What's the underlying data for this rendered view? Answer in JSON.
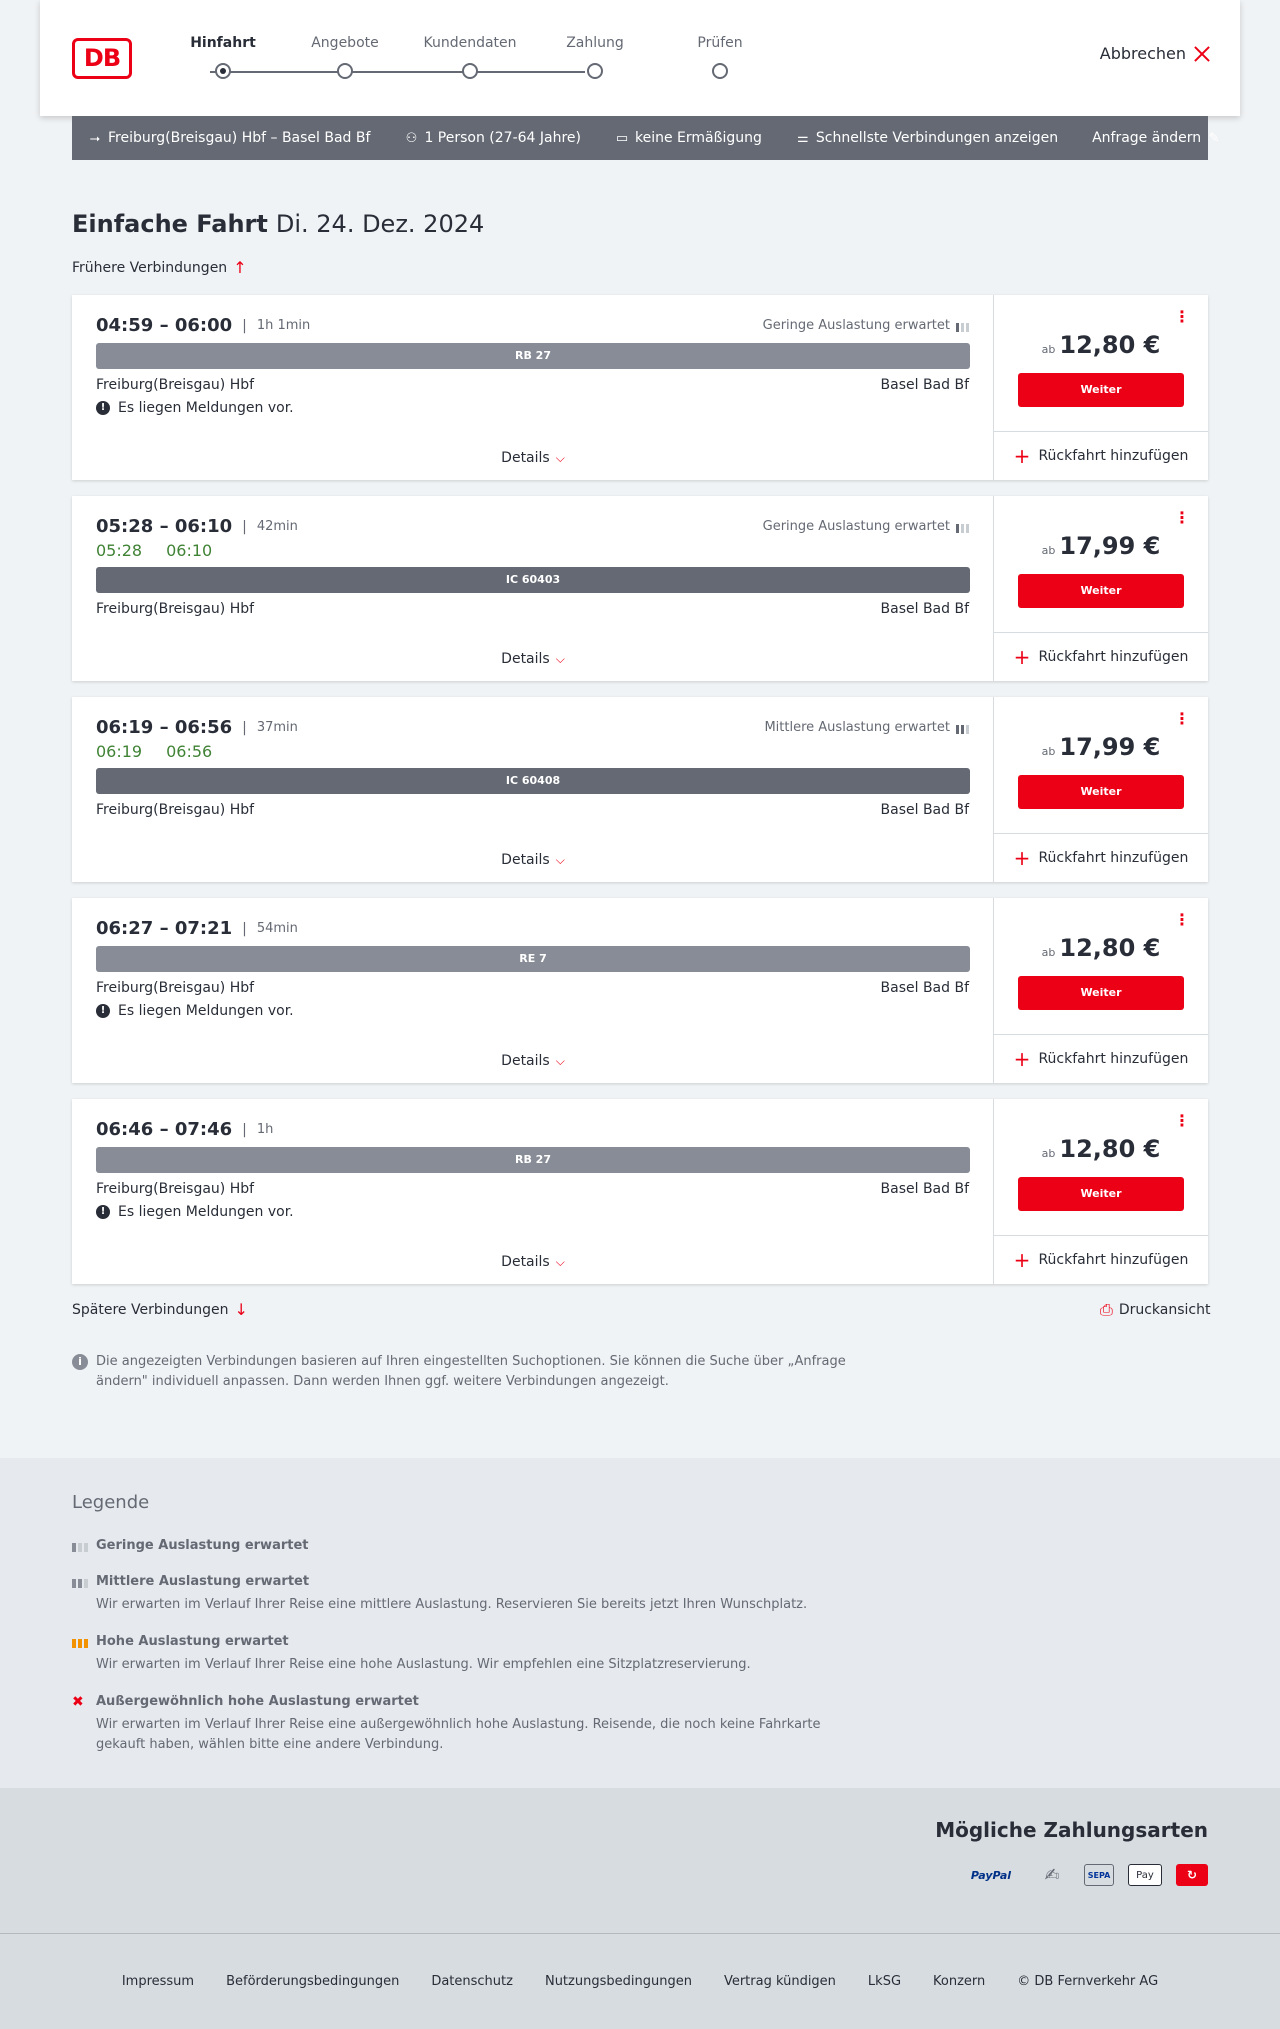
{
  "header": {
    "logo": "DB",
    "steps": [
      {
        "label": "Hinfahrt",
        "active": true
      },
      {
        "label": "Angebote",
        "active": false
      },
      {
        "label": "Kundendaten",
        "active": false
      },
      {
        "label": "Zahlung",
        "active": false
      },
      {
        "label": "Prüfen",
        "active": false
      }
    ],
    "cancel": "Abbrechen"
  },
  "searchbar": {
    "route": "Freiburg(Breisgau) Hbf – Basel Bad Bf",
    "travelers": "1 Person (27-64 Jahre)",
    "discount": "keine Ermäßigung",
    "fastest": "Schnellste Verbindungen anzeigen",
    "edit": "Anfrage ändern"
  },
  "title": {
    "type": "Einfache Fahrt",
    "date": "Di. 24. Dez. 2024"
  },
  "earlier": "Frühere Verbindungen",
  "later": "Spätere Verbindungen",
  "print": "Druckansicht",
  "labels": {
    "details": "Details",
    "from": "ab",
    "continue": "Weiter",
    "add_return": "Rückfahrt hinzufügen"
  },
  "connections": [
    {
      "times": "04:59 – 06:00",
      "duration": "1h 1min",
      "load": "Geringe Auslastung erwartet",
      "train": "RB 27",
      "from": "Freiburg(Breisgau) Hbf",
      "to": "Basel Bad Bf",
      "message": "Es liegen Meldungen vor.",
      "price": "12,80 €"
    },
    {
      "times": "05:28 – 06:10",
      "duration": "42min",
      "rt_dep": "05:28",
      "rt_arr": "06:10",
      "load": "Geringe Auslastung erwartet",
      "train": "IC 60403",
      "from": "Freiburg(Breisgau) Hbf",
      "to": "Basel Bad Bf",
      "price": "17,99 €"
    },
    {
      "times": "06:19 – 06:56",
      "duration": "37min",
      "rt_dep": "06:19",
      "rt_arr": "06:56",
      "load": "Mittlere Auslastung erwartet",
      "train": "IC 60408",
      "from": "Freiburg(Breisgau) Hbf",
      "to": "Basel Bad Bf",
      "price": "17,99 €"
    },
    {
      "times": "06:27 – 07:21",
      "duration": "54min",
      "train": "RE 7",
      "from": "Freiburg(Breisgau) Hbf",
      "to": "Basel Bad Bf",
      "message": "Es liegen Meldungen vor.",
      "price": "12,80 €"
    },
    {
      "times": "06:46 – 07:46",
      "duration": "1h",
      "train": "RB 27",
      "from": "Freiburg(Breisgau) Hbf",
      "to": "Basel Bad Bf",
      "message": "Es liegen Meldungen vor.",
      "price": "12,80 €"
    }
  ],
  "info": "Die angezeigten Verbindungen basieren auf Ihren eingestellten Suchoptionen. Sie können die Suche über „Anfrage ändern\" individuell anpassen. Dann werden Ihnen ggf. weitere Verbindungen angezeigt.",
  "legend": {
    "title": "Legende",
    "items": [
      {
        "title": "Geringe Auslastung erwartet",
        "desc": ""
      },
      {
        "title": "Mittlere Auslastung erwartet",
        "desc": "Wir erwarten im Verlauf Ihrer Reise eine mittlere Auslastung. Reservieren Sie bereits jetzt Ihren Wunschplatz."
      },
      {
        "title": "Hohe Auslastung erwartet",
        "desc": "Wir erwarten im Verlauf Ihrer Reise eine hohe Auslastung. Wir empfehlen eine Sitzplatzreservierung."
      },
      {
        "title": "Außergewöhnlich hohe Auslastung erwartet",
        "desc": "Wir erwarten im Verlauf Ihrer Reise eine außergewöhnlich hohe Auslastung. Reisende, die noch keine Fahrkarte gekauft haben, wählen bitte eine andere Verbindung."
      }
    ]
  },
  "payment": {
    "title": "Mögliche Zahlungsarten",
    "paypal": "PayPal",
    "sepa": "SEPA",
    "apple": "Pay"
  },
  "footer": [
    "Impressum",
    "Beförderungsbedingungen",
    "Datenschutz",
    "Nutzungsbedingungen",
    "Vertrag kündigen",
    "LkSG",
    "Konzern",
    "© DB Fernverkehr AG"
  ],
  "colors": {
    "brand": "#ec0016",
    "realtime": "#408335",
    "bar": "#646973"
  }
}
